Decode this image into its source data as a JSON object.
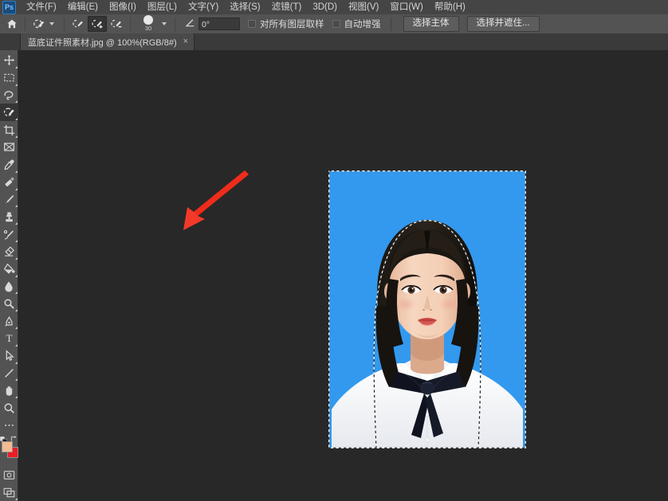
{
  "app": {
    "name": "Adobe Photoshop",
    "logo_text": "Ps",
    "canvas_bg": "#282828",
    "chrome_bg": "#535353",
    "menubar_bg": "#454545"
  },
  "menubar": {
    "items": [
      {
        "label": "文件(F)",
        "name": "menu-file"
      },
      {
        "label": "编辑(E)",
        "name": "menu-edit"
      },
      {
        "label": "图像(I)",
        "name": "menu-image"
      },
      {
        "label": "图层(L)",
        "name": "menu-layer"
      },
      {
        "label": "文字(Y)",
        "name": "menu-type"
      },
      {
        "label": "选择(S)",
        "name": "menu-select"
      },
      {
        "label": "滤镜(T)",
        "name": "menu-filter"
      },
      {
        "label": "3D(D)",
        "name": "menu-3d"
      },
      {
        "label": "视图(V)",
        "name": "menu-view"
      },
      {
        "label": "窗口(W)",
        "name": "menu-window"
      },
      {
        "label": "帮助(H)",
        "name": "menu-help"
      }
    ]
  },
  "options_bar": {
    "home_icon": "home-icon",
    "active_tool_icon": "quick-selection-tool-icon",
    "preset_caret": "chevron-down-icon",
    "selection_modes": [
      {
        "name": "new-selection-mode",
        "icon": "brush-new-icon",
        "active": false
      },
      {
        "name": "add-to-selection-mode",
        "icon": "brush-plus-icon",
        "active": true
      },
      {
        "name": "subtract-from-selection-mode",
        "icon": "brush-minus-icon",
        "active": false
      }
    ],
    "brush_size_label": "30",
    "brush_caret": "chevron-down-icon",
    "angle_icon": "angle-icon",
    "angle_value": "0°",
    "checkboxes": [
      {
        "label": "对所有图层取样",
        "name": "sample-all-layers-checkbox",
        "checked": false
      },
      {
        "label": "自动增强",
        "name": "auto-enhance-checkbox",
        "checked": false
      }
    ],
    "buttons": [
      {
        "label": "选择主体",
        "name": "select-subject-button"
      },
      {
        "label": "选择并遮住...",
        "name": "select-and-mask-button"
      }
    ]
  },
  "tabbar": {
    "tab_title": "蓝底证件照素材.jpg @ 100%(RGB/8#)",
    "close_glyph": "×"
  },
  "toolbar": {
    "tools": [
      {
        "name": "move-tool",
        "icon": "move-icon",
        "has_flyout": true,
        "active": false
      },
      {
        "name": "rectangular-marquee-tool",
        "icon": "marquee-icon",
        "has_flyout": true,
        "active": false
      },
      {
        "name": "lasso-tool",
        "icon": "lasso-icon",
        "has_flyout": true,
        "active": false
      },
      {
        "name": "quick-selection-tool",
        "icon": "quick-selection-icon",
        "has_flyout": true,
        "active": true
      },
      {
        "name": "crop-tool",
        "icon": "crop-icon",
        "has_flyout": true,
        "active": false
      },
      {
        "name": "frame-tool",
        "icon": "frame-icon",
        "has_flyout": false,
        "active": false
      },
      {
        "name": "eyedropper-tool",
        "icon": "eyedropper-icon",
        "has_flyout": true,
        "active": false
      },
      {
        "name": "spot-healing-brush-tool",
        "icon": "healing-brush-icon",
        "has_flyout": true,
        "active": false
      },
      {
        "name": "brush-tool",
        "icon": "brush-icon",
        "has_flyout": true,
        "active": false
      },
      {
        "name": "clone-stamp-tool",
        "icon": "clone-stamp-icon",
        "has_flyout": true,
        "active": false
      },
      {
        "name": "history-brush-tool",
        "icon": "history-brush-icon",
        "has_flyout": true,
        "active": false
      },
      {
        "name": "eraser-tool",
        "icon": "eraser-icon",
        "has_flyout": true,
        "active": false
      },
      {
        "name": "gradient-tool",
        "icon": "paint-bucket-icon",
        "has_flyout": true,
        "active": false
      },
      {
        "name": "blur-tool",
        "icon": "blur-drop-icon",
        "has_flyout": true,
        "active": false
      },
      {
        "name": "dodge-tool",
        "icon": "dodge-icon",
        "has_flyout": true,
        "active": false
      },
      {
        "name": "pen-tool",
        "icon": "pen-icon",
        "has_flyout": true,
        "active": false
      },
      {
        "name": "horizontal-type-tool",
        "icon": "type-T-icon",
        "has_flyout": true,
        "active": false
      },
      {
        "name": "path-selection-tool",
        "icon": "path-arrow-icon",
        "has_flyout": true,
        "active": false
      },
      {
        "name": "line-shape-tool",
        "icon": "line-icon",
        "has_flyout": true,
        "active": false
      },
      {
        "name": "hand-tool",
        "icon": "hand-icon",
        "has_flyout": true,
        "active": false
      },
      {
        "name": "zoom-tool",
        "icon": "magnifier-icon",
        "has_flyout": false,
        "active": false
      },
      {
        "name": "edit-toolbar-button",
        "icon": "ellipsis-icon",
        "has_flyout": false,
        "active": false
      }
    ],
    "color_swatches": {
      "foreground": "#f2bb92",
      "background": "#ec1c24",
      "swap_icon": "swap-colors-icon",
      "default_icon": "default-colors-icon"
    },
    "bottom_modes": [
      {
        "name": "quick-mask-mode-button",
        "icon": "quick-mask-icon"
      },
      {
        "name": "screen-mode-button",
        "icon": "screen-mode-icon"
      }
    ]
  },
  "document": {
    "image_name": "蓝底证件照素材.jpg",
    "zoom": "100%",
    "color_mode": "RGB/8#",
    "background_color": "#3399ee",
    "selection_active": true,
    "selection_description": "marching-ants around subject"
  },
  "annotation": {
    "arrow_color": "#f33a2a",
    "arrow_name": "red-pointer-arrow",
    "points_to": "selection-edge"
  }
}
